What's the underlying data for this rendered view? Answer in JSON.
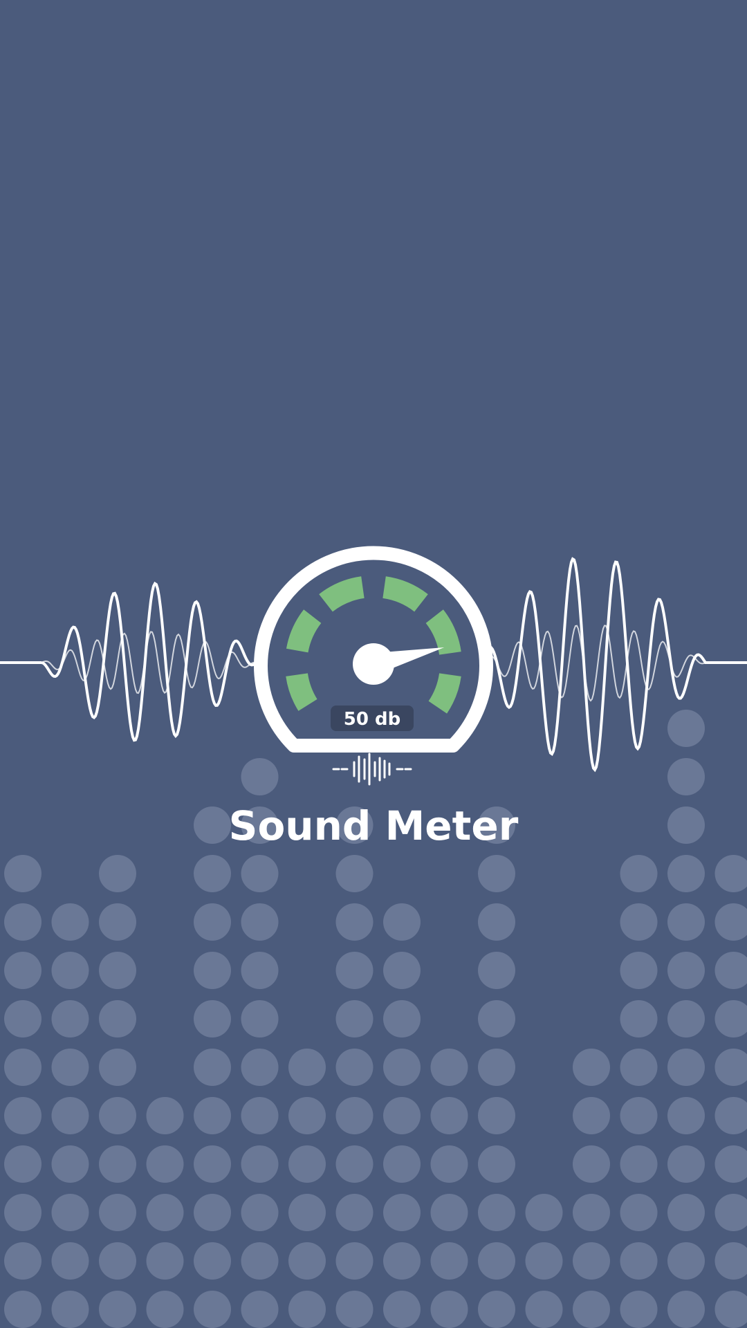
{
  "app": {
    "title": "Sound Meter"
  },
  "meter": {
    "reading_label": "50 db",
    "needle_value_fraction": 0.82
  },
  "colors": {
    "background": "#4b5b7c",
    "accent_segments": "#7fbf7f",
    "gauge_stroke": "#ffffff",
    "dots": "#6a7896",
    "badge": "#3a4660"
  },
  "background_bars": {
    "dot_counts": [
      10,
      9,
      10,
      5,
      11,
      12,
      6,
      11,
      9,
      6,
      11,
      3,
      6,
      10,
      13,
      10
    ]
  },
  "icons": {
    "gauge": "speedometer-icon",
    "waveform": "soundwave-icon",
    "mini_waveform": "mini-soundwave-icon"
  }
}
